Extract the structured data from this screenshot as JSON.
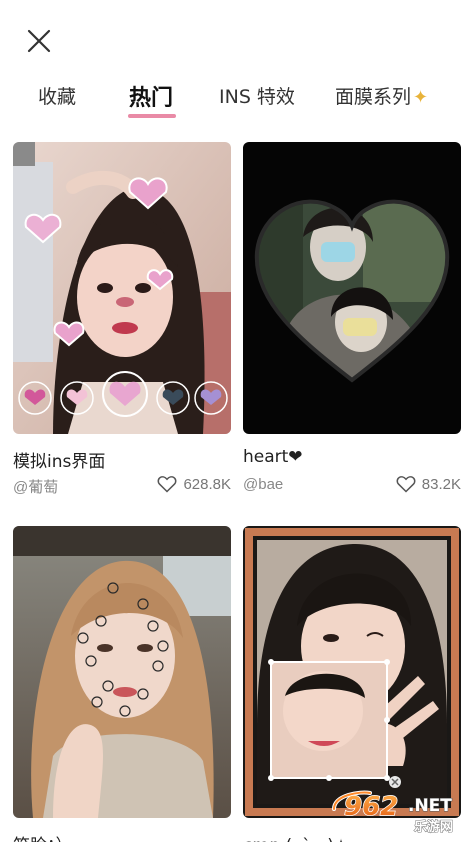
{
  "header": {
    "close_icon": "close-icon"
  },
  "tabs": [
    {
      "label": "收藏",
      "active": false
    },
    {
      "label": "热门",
      "active": true
    },
    {
      "label": "INS 特效",
      "active": false
    },
    {
      "label": "面膜系列",
      "active": false,
      "icon": "sparkle-icon"
    }
  ],
  "cards": [
    {
      "title": "模拟ins界面",
      "author": "@葡萄",
      "likes": "628.8K"
    },
    {
      "title": "heart❤",
      "author": "@bae",
      "likes": "83.2K"
    },
    {
      "title": "笑脸：）",
      "author": "",
      "likes": ""
    },
    {
      "title": "crop (｡•̀ᴗ-)✧",
      "author": "",
      "likes": ""
    }
  ],
  "watermark": {
    "number": "962",
    "suffix": "NET",
    "subtitle": "乐游网"
  },
  "colors": {
    "accent": "#e98aa6",
    "muted_text": "#888888",
    "sparkle": "#e8b33a"
  }
}
